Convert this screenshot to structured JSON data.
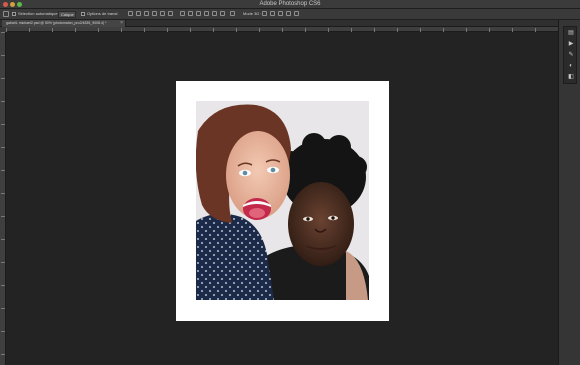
{
  "window": {
    "title": "Adobe Photoshop CS6"
  },
  "options_bar": {
    "auto_select_label": "Sélection automatique :",
    "auto_select_value": "Calque",
    "transform_label": "Options de transf.",
    "mode_3d_label": "Mode 3D :"
  },
  "document_tab": {
    "label": "gabarit- michael2.psd @ 50% (photomaton_pro2/4835_9008.4) *",
    "close_symbol": "×"
  },
  "canvas": {
    "background_color": "#232323",
    "document_color": "#ffffff"
  },
  "panels": {
    "icons": [
      "history-icon",
      "play-icon",
      "brush-icon",
      "adjust-icon",
      "layers-icon"
    ]
  }
}
